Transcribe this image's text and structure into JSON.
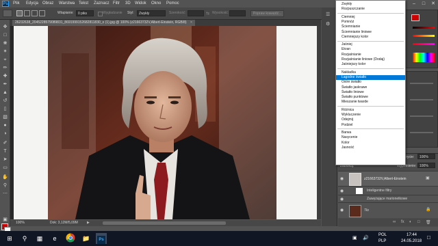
{
  "menubar": {
    "logo": "Ps",
    "items": [
      "Plik",
      "Edycja",
      "Obraz",
      "Warstwa",
      "Tekst",
      "Zaznacz",
      "Filtr",
      "3D",
      "Widok",
      "Okno",
      "Pomoc"
    ]
  },
  "options": {
    "feather_label": "Wtapianie:",
    "feather_value": "0 piks",
    "smooth_label": "Wygładzanie",
    "style_label": "Styl:",
    "style_value": "Zwykły",
    "width_label": "Szerokość:",
    "height_label": "Wysokość:",
    "refine_button": "Popraw krawędź..."
  },
  "document": {
    "tab_title": "26232638_2045228579089831_8691999152682811830_o (1).jpg @ 100% (z21663732V,Albert-Einstein, RGB/8)",
    "zoom": "100%",
    "doc_info": "Dok: 3,12M/5,09M"
  },
  "blend_menu": {
    "groups": [
      [
        "Zwykły",
        "Rozpuszczanie"
      ],
      [
        "Ciemniej",
        "Pomnóż",
        "Ściemnianie",
        "Ściemnianie liniowe",
        "Ciemniejszy kolor"
      ],
      [
        "Jaśniej",
        "Ekran",
        "Rozjaśnianie",
        "Rozjaśnianie liniowe (Dodaj)",
        "Jaśniejszy kolor"
      ],
      [
        "Nakładka",
        "Łagodne światło",
        "Ostre światło",
        "Światło jaskrawe",
        "Światło liniowe",
        "Światło punktowe",
        "Mieszanie twarde"
      ],
      [
        "Różnica",
        "Wykluczenie",
        "Odejmij",
        "Podziel"
      ],
      [
        "Barwa",
        "Nasycenie",
        "Kolor",
        "Jasność"
      ]
    ],
    "selected": "Łagodne światło"
  },
  "layers": {
    "lock_label": "Zablokuj:",
    "opacity_label": "Krycie:",
    "opacity_value": "100%",
    "fill_label": "Wypełnienie:",
    "fill_value": "100%",
    "items": [
      {
        "name": "z21663732V,Albert-Einstein"
      },
      {
        "name": "Inteligentne filtry"
      },
      {
        "name": "Zawężające marionetkowe"
      },
      {
        "name": "Tło"
      }
    ]
  },
  "colors": {
    "foreground": "#cc0000",
    "background": "#ffffff",
    "selection": "#0078d7",
    "accent_ps": "#31a8ff"
  },
  "taskbar": {
    "icons": [
      "windows-start-icon",
      "search-icon",
      "task-view-icon",
      "chrome-icon",
      "file-explorer-icon",
      "photoshop-icon"
    ],
    "lang_top": "POL",
    "lang_bottom": "PLP",
    "time": "17:44",
    "date": "24.05.2018"
  }
}
